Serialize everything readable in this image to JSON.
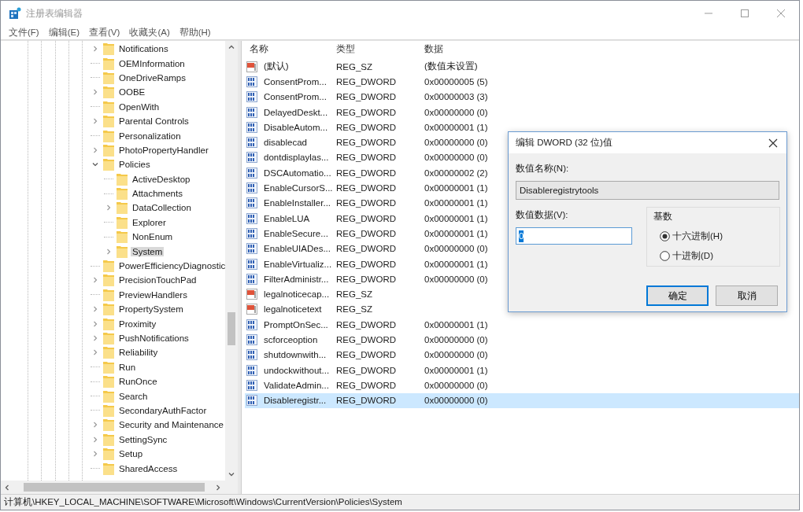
{
  "window": {
    "title": "注册表编辑器",
    "active": false
  },
  "menu": [
    "文件(F)",
    "编辑(E)",
    "查看(V)",
    "收藏夹(A)",
    "帮助(H)"
  ],
  "tree": [
    {
      "label": "Notifications",
      "has_subkeys": true,
      "selected": false
    },
    {
      "label": "OEMInformation",
      "has_subkeys": false,
      "selected": false
    },
    {
      "label": "OneDriveRamps",
      "has_subkeys": false,
      "selected": false
    },
    {
      "label": "OOBE",
      "has_subkeys": true,
      "selected": false
    },
    {
      "label": "OpenWith",
      "has_subkeys": false,
      "selected": false
    },
    {
      "label": "Parental Controls",
      "has_subkeys": true,
      "selected": false
    },
    {
      "label": "Personalization",
      "has_subkeys": false,
      "selected": false
    },
    {
      "label": "PhotoPropertyHandler",
      "has_subkeys": true,
      "selected": false
    },
    {
      "label": "Policies",
      "has_subkeys": true,
      "selected": false,
      "expanded": true,
      "children": [
        {
          "label": "ActiveDesktop",
          "has_subkeys": false,
          "selected": false
        },
        {
          "label": "Attachments",
          "has_subkeys": false,
          "selected": false
        },
        {
          "label": "DataCollection",
          "has_subkeys": true,
          "selected": false
        },
        {
          "label": "Explorer",
          "has_subkeys": false,
          "selected": false
        },
        {
          "label": "NonEnum",
          "has_subkeys": false,
          "selected": false
        },
        {
          "label": "System",
          "has_subkeys": true,
          "selected": true
        }
      ]
    },
    {
      "label": "PowerEfficiencyDiagnostic",
      "has_subkeys": false,
      "selected": false
    },
    {
      "label": "PrecisionTouchPad",
      "has_subkeys": true,
      "selected": false
    },
    {
      "label": "PreviewHandlers",
      "has_subkeys": false,
      "selected": false
    },
    {
      "label": "PropertySystem",
      "has_subkeys": true,
      "selected": false
    },
    {
      "label": "Proximity",
      "has_subkeys": true,
      "selected": false
    },
    {
      "label": "PushNotifications",
      "has_subkeys": true,
      "selected": false
    },
    {
      "label": "Reliability",
      "has_subkeys": true,
      "selected": false
    },
    {
      "label": "Run",
      "has_subkeys": false,
      "selected": false
    },
    {
      "label": "RunOnce",
      "has_subkeys": false,
      "selected": false
    },
    {
      "label": "Search",
      "has_subkeys": false,
      "selected": false
    },
    {
      "label": "SecondaryAuthFactor",
      "has_subkeys": false,
      "selected": false
    },
    {
      "label": "Security and Maintenance",
      "has_subkeys": true,
      "selected": false
    },
    {
      "label": "SettingSync",
      "has_subkeys": true,
      "selected": false
    },
    {
      "label": "Setup",
      "has_subkeys": true,
      "selected": false
    },
    {
      "label": "SharedAccess",
      "has_subkeys": false,
      "selected": false
    }
  ],
  "values": {
    "columns": [
      "名称",
      "类型",
      "数据"
    ],
    "rows": [
      {
        "kind": "sz",
        "name": "(默认)",
        "type": "REG_SZ",
        "data": "(数值未设置)",
        "selected": false
      },
      {
        "kind": "dword",
        "name": "ConsentProm...",
        "type": "REG_DWORD",
        "data": "0x00000005 (5)",
        "selected": false
      },
      {
        "kind": "dword",
        "name": "ConsentProm...",
        "type": "REG_DWORD",
        "data": "0x00000003 (3)",
        "selected": false
      },
      {
        "kind": "dword",
        "name": "DelayedDeskt...",
        "type": "REG_DWORD",
        "data": "0x00000000 (0)",
        "selected": false
      },
      {
        "kind": "dword",
        "name": "DisableAutom...",
        "type": "REG_DWORD",
        "data": "0x00000001 (1)",
        "selected": false
      },
      {
        "kind": "dword",
        "name": "disablecad",
        "type": "REG_DWORD",
        "data": "0x00000000 (0)",
        "selected": false
      },
      {
        "kind": "dword",
        "name": "dontdisplaylas...",
        "type": "REG_DWORD",
        "data": "0x00000000 (0)",
        "selected": false
      },
      {
        "kind": "dword",
        "name": "DSCAutomatio...",
        "type": "REG_DWORD",
        "data": "0x00000002 (2)",
        "selected": false
      },
      {
        "kind": "dword",
        "name": "EnableCursorS...",
        "type": "REG_DWORD",
        "data": "0x00000001 (1)",
        "selected": false
      },
      {
        "kind": "dword",
        "name": "EnableInstaller...",
        "type": "REG_DWORD",
        "data": "0x00000001 (1)",
        "selected": false
      },
      {
        "kind": "dword",
        "name": "EnableLUA",
        "type": "REG_DWORD",
        "data": "0x00000001 (1)",
        "selected": false
      },
      {
        "kind": "dword",
        "name": "EnableSecure...",
        "type": "REG_DWORD",
        "data": "0x00000001 (1)",
        "selected": false
      },
      {
        "kind": "dword",
        "name": "EnableUIADes...",
        "type": "REG_DWORD",
        "data": "0x00000000 (0)",
        "selected": false
      },
      {
        "kind": "dword",
        "name": "EnableVirtualiz...",
        "type": "REG_DWORD",
        "data": "0x00000001 (1)",
        "selected": false
      },
      {
        "kind": "dword",
        "name": "FilterAdministr...",
        "type": "REG_DWORD",
        "data": "0x00000000 (0)",
        "selected": false
      },
      {
        "kind": "sz",
        "name": "legalnoticecap...",
        "type": "REG_SZ",
        "selected": false
      },
      {
        "kind": "sz",
        "name": "legalnoticetext",
        "type": "REG_SZ",
        "selected": false
      },
      {
        "kind": "dword",
        "name": "PromptOnSec...",
        "type": "REG_DWORD",
        "data": "0x00000001 (1)",
        "selected": false
      },
      {
        "kind": "dword",
        "name": "scforceoption",
        "type": "REG_DWORD",
        "data": "0x00000000 (0)",
        "selected": false
      },
      {
        "kind": "dword",
        "name": "shutdownwith...",
        "type": "REG_DWORD",
        "data": "0x00000000 (0)",
        "selected": false
      },
      {
        "kind": "dword",
        "name": "undockwithout...",
        "type": "REG_DWORD",
        "data": "0x00000001 (1)",
        "selected": false
      },
      {
        "kind": "dword",
        "name": "ValidateAdmin...",
        "type": "REG_DWORD",
        "data": "0x00000000 (0)",
        "selected": false
      },
      {
        "kind": "dword",
        "name": "Disableregistr...",
        "type": "REG_DWORD",
        "data": "0x00000000 (0)",
        "selected": true
      }
    ]
  },
  "status_bar": "计算机\\HKEY_LOCAL_MACHINE\\SOFTWARE\\Microsoft\\Windows\\CurrentVersion\\Policies\\System",
  "dialog": {
    "title": "编辑 DWORD (32 位)值",
    "name_label": "数值名称(N):",
    "name_value": "Disableregistrytools",
    "data_label": "数值数据(V):",
    "data_value": "0",
    "base_label": "基数",
    "bases": [
      {
        "label": "十六进制(H)",
        "selected": true
      },
      {
        "label": "十进制(D)",
        "selected": false
      }
    ],
    "buttons": [
      {
        "label": "确定",
        "default": true
      },
      {
        "label": "取消",
        "default": false
      }
    ]
  }
}
